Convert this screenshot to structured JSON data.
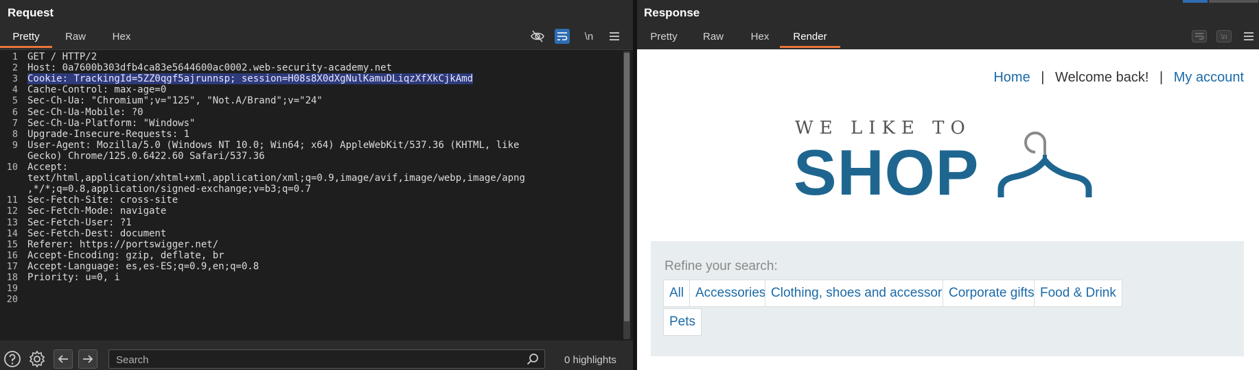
{
  "request": {
    "title": "Request",
    "tabs": [
      "Pretty",
      "Raw",
      "Hex"
    ],
    "active_tab": "Pretty",
    "toolbar_icons": [
      "eye-off-icon",
      "word-wrap-icon",
      "newline-icon",
      "menu-icon"
    ],
    "newline_label": "\\n",
    "lines": [
      {
        "n": "1",
        "text": "GET / HTTP/2"
      },
      {
        "n": "2",
        "text": "Host: 0a7600b303dfb4ca83e5644600ac0002.web-security-academy.net"
      },
      {
        "n": "3",
        "text": "Cookie: TrackingId=5ZZ0qgf5ajrunnsp; session=H08s8X0dXgNulKamuDLiqzXfXkCjkAmd",
        "highlighted": true
      },
      {
        "n": "4",
        "text": "Cache-Control: max-age=0"
      },
      {
        "n": "5",
        "text": "Sec-Ch-Ua: \"Chromium\";v=\"125\", \"Not.A/Brand\";v=\"24\""
      },
      {
        "n": "6",
        "text": "Sec-Ch-Ua-Mobile: ?0"
      },
      {
        "n": "7",
        "text": "Sec-Ch-Ua-Platform: \"Windows\""
      },
      {
        "n": "8",
        "text": "Upgrade-Insecure-Requests: 1"
      },
      {
        "n": "9",
        "text": "User-Agent: Mozilla/5.0 (Windows NT 10.0; Win64; x64) AppleWebKit/537.36 (KHTML, like"
      },
      {
        "n": "",
        "text": "Gecko) Chrome/125.0.6422.60 Safari/537.36"
      },
      {
        "n": "10",
        "text": "Accept:"
      },
      {
        "n": "",
        "text": "text/html,application/xhtml+xml,application/xml;q=0.9,image/avif,image/webp,image/apng"
      },
      {
        "n": "",
        "text": ",*/*;q=0.8,application/signed-exchange;v=b3;q=0.7"
      },
      {
        "n": "11",
        "text": "Sec-Fetch-Site: cross-site"
      },
      {
        "n": "12",
        "text": "Sec-Fetch-Mode: navigate"
      },
      {
        "n": "13",
        "text": "Sec-Fetch-User: ?1"
      },
      {
        "n": "14",
        "text": "Sec-Fetch-Dest: document"
      },
      {
        "n": "15",
        "text": "Referer: https://portswigger.net/"
      },
      {
        "n": "16",
        "text": "Accept-Encoding: gzip, deflate, br"
      },
      {
        "n": "17",
        "text": "Accept-Language: es,es-ES;q=0.9,en;q=0.8"
      },
      {
        "n": "18",
        "text": "Priority: u=0, i"
      },
      {
        "n": "19",
        "text": ""
      },
      {
        "n": "20",
        "text": ""
      }
    ],
    "footer": {
      "search_placeholder": "Search",
      "highlights": "0 highlights"
    }
  },
  "response": {
    "title": "Response",
    "tabs": [
      "Pretty",
      "Raw",
      "Hex",
      "Render"
    ],
    "active_tab": "Render",
    "render": {
      "nav": {
        "home": "Home",
        "sep": "|",
        "welcome": "Welcome back!",
        "account": "My account"
      },
      "logo": {
        "tagline": "WE LIKE TO",
        "word": "SHOP"
      },
      "refine_label": "Refine your search:",
      "filters": [
        "All",
        "Accessories",
        "Clothing, shoes and accessories",
        "Corporate gifts",
        "Food & Drink",
        "Pets"
      ]
    }
  },
  "colors": {
    "accent_tab": "#e8743b",
    "link": "#1a6aa8",
    "logo_blue": "#1e6690",
    "highlight": "#2e3a7a"
  }
}
